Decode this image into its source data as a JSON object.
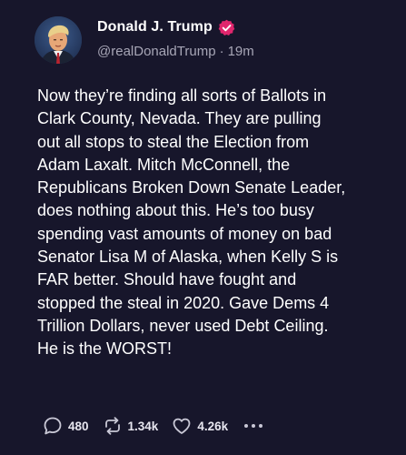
{
  "post": {
    "author_name": "Donald J. Trump",
    "handle": "@realDonaldTrump",
    "separator": "·",
    "age": "19m",
    "lines": [
      "Now they’re finding all sorts of Ballots in",
      "Clark County, Nevada. They are pulling",
      "out all stops to steal the Election from",
      "Adam Laxalt. Mitch McConnell, the",
      "Republicans Broken Down Senate Leader,",
      "does nothing about this. He’s too busy",
      "spending vast amounts of money on bad",
      "Senator Lisa M of Alaska, when Kelly S is",
      "FAR better. Should have fought and",
      "stopped the steal in 2020. Gave Dems 4",
      "Trillion Dollars, never used Debt Ceiling.",
      "He is the WORST!"
    ]
  },
  "actions": {
    "reply_count": "480",
    "retruth_count": "1.34k",
    "like_count": "4.26k"
  },
  "icons": {
    "verified": "verified-badge-icon",
    "reply": "speech-bubble-icon",
    "retruth": "retruth-arrows-icon",
    "like": "heart-icon",
    "more": "ellipsis-icon"
  },
  "colors": {
    "background": "#17162b",
    "verified": "#e0266d",
    "secondary_text": "#a7a6b6"
  }
}
